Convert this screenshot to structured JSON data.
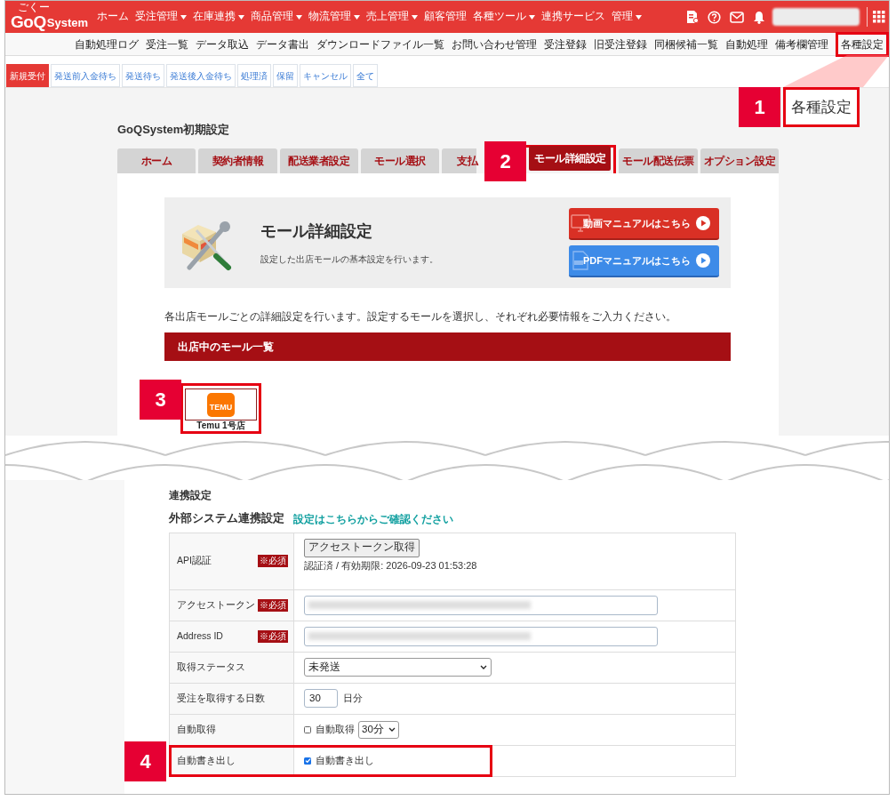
{
  "top_nav": {
    "logo_ruby": "ごくー",
    "logo": "GoQ",
    "logo_suffix": "System",
    "menu": [
      {
        "label": "ホーム",
        "has_caret": false
      },
      {
        "label": "受注管理",
        "has_caret": true
      },
      {
        "label": "在庫連携",
        "has_caret": true
      },
      {
        "label": "商品管理",
        "has_caret": true
      },
      {
        "label": "物流管理",
        "has_caret": true
      },
      {
        "label": "売上管理",
        "has_caret": true
      },
      {
        "label": "顧客管理",
        "has_caret": false
      },
      {
        "label": "各種ツール",
        "has_caret": true
      },
      {
        "label": "連携サービス",
        "has_caret": false
      },
      {
        "label": "管理",
        "has_caret": true
      }
    ]
  },
  "sub_nav": [
    {
      "label": "自動処理ログ",
      "highlighted": false
    },
    {
      "label": "受注一覧",
      "highlighted": false
    },
    {
      "label": "データ取込",
      "highlighted": false
    },
    {
      "label": "データ書出",
      "highlighted": false
    },
    {
      "label": "ダウンロードファイル一覧",
      "highlighted": false
    },
    {
      "label": "お問い合わせ管理",
      "highlighted": false
    },
    {
      "label": "受注登録",
      "highlighted": false
    },
    {
      "label": "旧受注登録",
      "highlighted": false
    },
    {
      "label": "同梱候補一覧",
      "highlighted": false
    },
    {
      "label": "自動処理",
      "highlighted": false
    },
    {
      "label": "備考欄管理",
      "highlighted": false
    },
    {
      "label": "各種設定",
      "highlighted": true
    }
  ],
  "status_tabs": [
    {
      "label": "新規受付",
      "selected": true
    },
    {
      "label": "発送前入金待ち",
      "selected": false
    },
    {
      "label": "発送待ち",
      "selected": false
    },
    {
      "label": "発送後入金待ち",
      "selected": false
    },
    {
      "label": "処理済",
      "selected": false
    },
    {
      "label": "保留",
      "selected": false
    },
    {
      "label": "キャンセル",
      "selected": false
    },
    {
      "label": "全て",
      "selected": false
    }
  ],
  "page_title": "GoQSystem初期設定",
  "settings_tabs": [
    {
      "label": "ホーム",
      "selected": false,
      "highlighted": false
    },
    {
      "label": "契約者情報",
      "selected": false,
      "highlighted": false
    },
    {
      "label": "配送業者設定",
      "selected": false,
      "highlighted": false
    },
    {
      "label": "モール選択",
      "selected": false,
      "highlighted": false
    },
    {
      "label": "支払",
      "selected": false,
      "highlighted": false
    },
    {
      "label": "モール詳細設定",
      "selected": true,
      "highlighted": true
    },
    {
      "label": "モール配送伝票",
      "selected": false,
      "highlighted": false
    },
    {
      "label": "オプション設定",
      "selected": false,
      "highlighted": false
    }
  ],
  "header": {
    "title": "モール詳細設定",
    "subtitle": "設定した出店モールの基本設定を行います。",
    "buttons": [
      {
        "label": "動画マニュアルはこちら",
        "kind": "video"
      },
      {
        "label": "PDFマニュアルはこちら",
        "kind": "pdf"
      }
    ]
  },
  "description": "各出店モールごとの詳細設定を行います。設定するモールを選択し、それぞれ必要情報をご入力ください。",
  "mall_section_title": "出店中のモール一覧",
  "malls": [
    {
      "logo_text": "TEMU",
      "name": "Temu 1号店",
      "highlighted": true
    }
  ],
  "link_settings": {
    "heading": "連携設定",
    "subheading": "外部システム連携設定",
    "help_link": "設定はこちらからご確認ください",
    "rows": [
      {
        "kind": "auth",
        "label": "API認証",
        "required_tag": "※必須",
        "button": "アクセストークン取得",
        "status": "認証済 / 有効期限: 2026-09-23 01:53:28",
        "highlighted": false
      },
      {
        "kind": "redacted",
        "label": "アクセストークン",
        "required_tag": "※必須",
        "highlighted": false
      },
      {
        "kind": "redacted",
        "label": "Address ID",
        "required_tag": "※必須",
        "highlighted": false
      },
      {
        "kind": "select",
        "label": "取得ステータス",
        "value": "未発送",
        "highlighted": false
      },
      {
        "kind": "number",
        "label": "受注を取得する日数",
        "value": "30",
        "unit": "日分",
        "highlighted": false
      },
      {
        "kind": "check_select",
        "label": "自動取得",
        "checked": false,
        "check_label": "自動取得",
        "value": "30分",
        "highlighted": false
      },
      {
        "kind": "check",
        "label": "自動書き出し",
        "checked": true,
        "check_label": "自動書き出し",
        "highlighted": true
      }
    ]
  },
  "annotations": [
    {
      "number": "1",
      "label": "各種設定"
    },
    {
      "number": "2"
    },
    {
      "number": "3"
    },
    {
      "number": "4"
    }
  ]
}
